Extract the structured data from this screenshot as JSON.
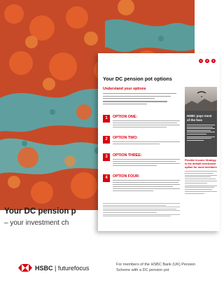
{
  "cover": {
    "title": "Your DC pension p",
    "subtitle": "– your investment ch",
    "logo_brand": "HSBC",
    "logo_divider": " | ",
    "logo_tagline": "futurefocus",
    "footer_note": "For members of the HSBC Bank (UK) Pension Scheme with a DC pension pot"
  },
  "inner_page": {
    "title": "Your DC pension pot options",
    "section_heading": "Understand your options",
    "nav_dots": [
      "4",
      "5",
      "6"
    ],
    "options": [
      {
        "number": "1",
        "title": "OPTION ONE:"
      },
      {
        "number": "2",
        "title": "OPTION TWO:"
      },
      {
        "number": "3",
        "title": "OPTION THREE:"
      },
      {
        "number": "4",
        "title": "OPTION FOUR:"
      }
    ],
    "callout_heading": "HSBC pays most of the fees",
    "side_red_text": "Flexible Income Strategy is the default investment option for most members"
  },
  "colors": {
    "brand_red": "#db0011",
    "callout_grey": "#4a4a4a"
  }
}
